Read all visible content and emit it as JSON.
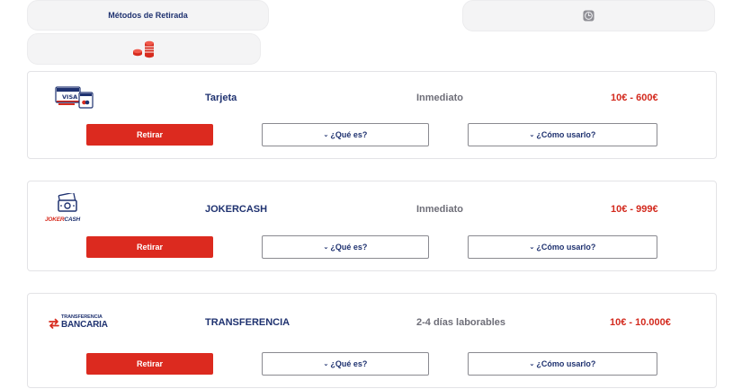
{
  "header": {
    "methods_label": "Métodos de Retirada"
  },
  "methods": [
    {
      "name": "Tarjeta",
      "time": "Inmediato",
      "range": "10€ - 600€",
      "logo": "visa-mastercard-cards-icon",
      "withdraw_label": "Retirar",
      "what_label": "¿Qué es?",
      "how_label": "¿Cómo usarlo?"
    },
    {
      "name": "JOKERCASH",
      "time": "Inmediato",
      "range": "10€ - 999€",
      "logo": "jokercash-logo",
      "logo_text": "JOKERCASH",
      "withdraw_label": "Retirar",
      "what_label": "¿Qué es?",
      "how_label": "¿Cómo usarlo?"
    },
    {
      "name": "TRANSFERENCIA",
      "time": "2-4 días laborables",
      "range": "10€ - 10.000€",
      "logo": "transferencia-bancaria-logo",
      "logo_text_top": "TRANSFERENCIA",
      "logo_text_bottom": "BANCARIA",
      "withdraw_label": "Retirar",
      "what_label": "¿Qué es?",
      "how_label": "¿Cómo usarlo?"
    }
  ],
  "icons": {
    "clock": "clock-icon",
    "coins": "coin-stack-icon",
    "chevron": "chevron-down-icon"
  },
  "colors": {
    "accent_red": "#dc2a1f",
    "brand_navy": "#1f3270",
    "muted_gray": "#6e6e78"
  }
}
